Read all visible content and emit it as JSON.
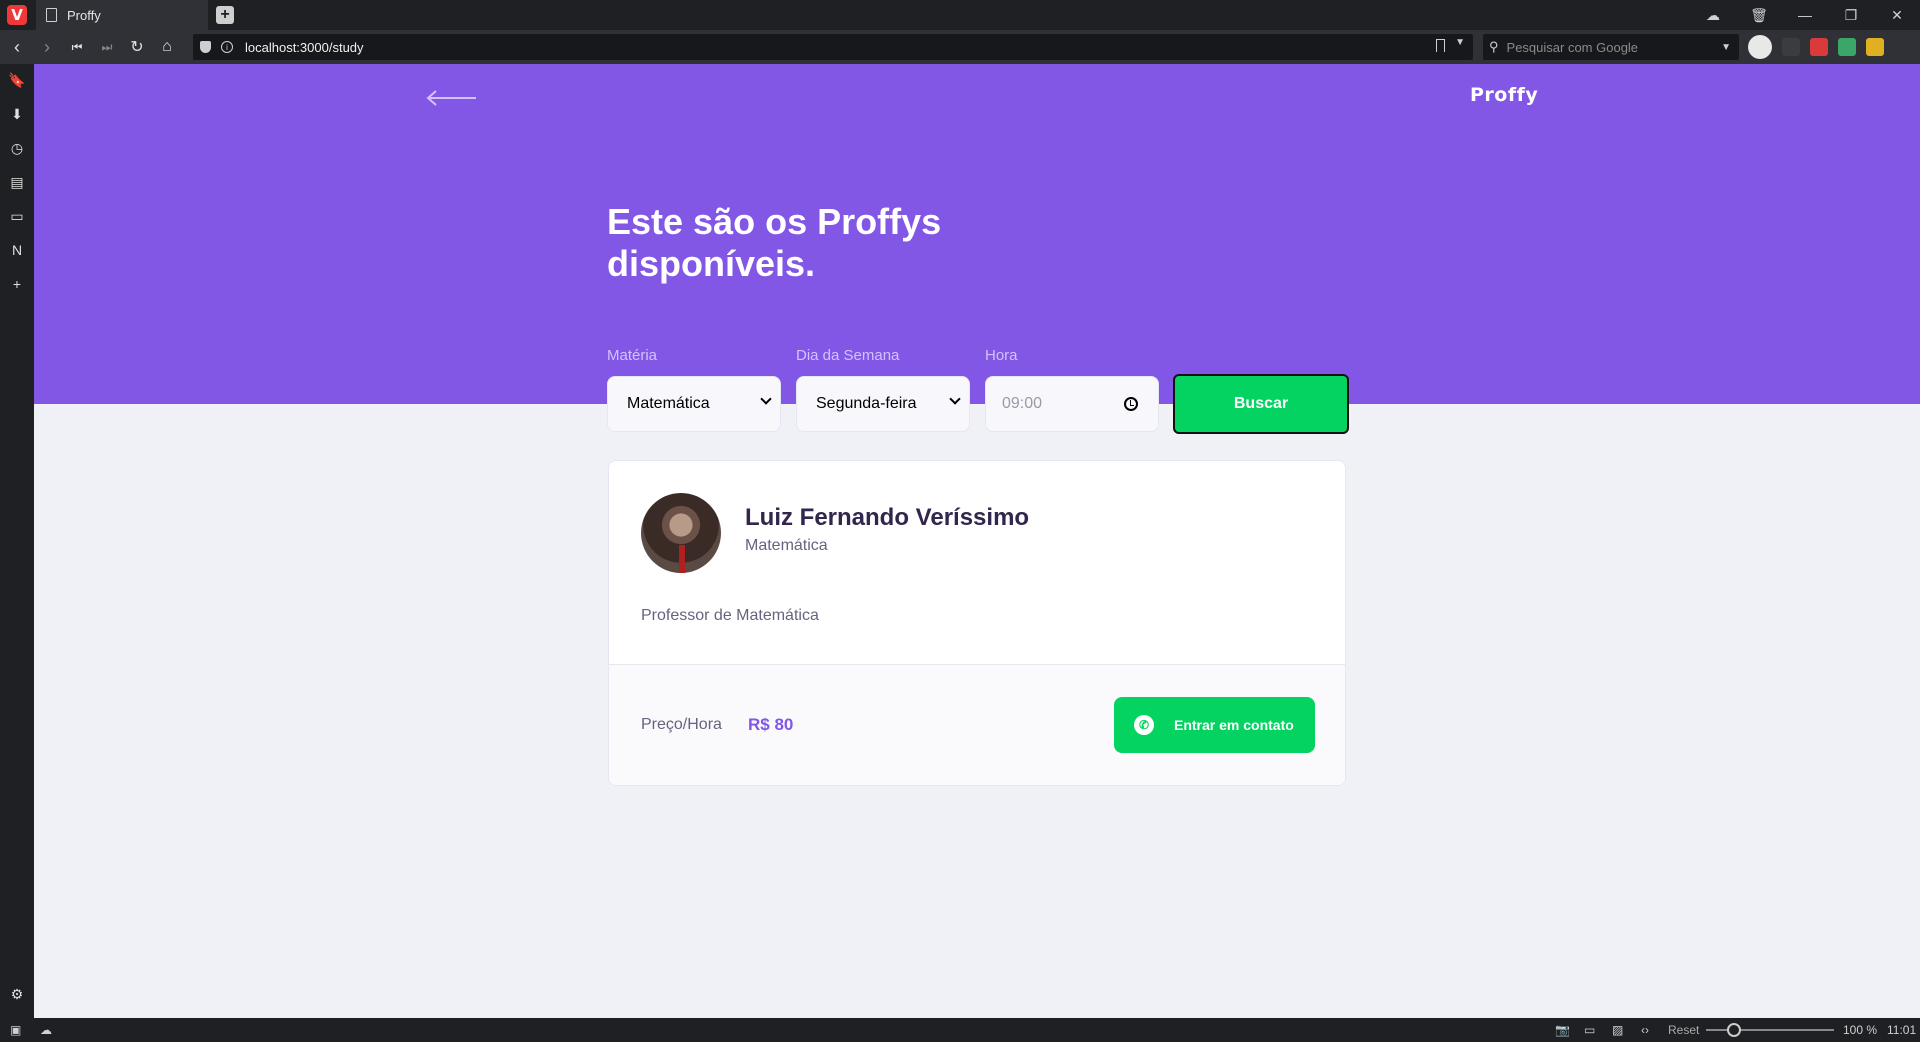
{
  "browser": {
    "tab_title": "Proffy",
    "url": "localhost:3000/study",
    "search_placeholder": "Pesquisar com Google",
    "status": {
      "reset_label": "Reset",
      "zoom": "100 %",
      "clock": "11:01"
    }
  },
  "header": {
    "brand": "Proffy",
    "title": "Este são os Proffys disponíveis."
  },
  "filters": {
    "subject_label": "Matéria",
    "subject_value": "Matemática",
    "weekday_label": "Dia da Semana",
    "weekday_value": "Segunda-feira",
    "time_label": "Hora",
    "time_value": "09:00",
    "search_button": "Buscar"
  },
  "teachers": [
    {
      "name": "Luiz Fernando Veríssimo",
      "subject": "Matemática",
      "bio": "Professor de Matemática",
      "price_label": "Preço/Hora",
      "price": "R$ 80",
      "contact_button": "Entrar em contato"
    }
  ],
  "colors": {
    "primary": "#8257e5",
    "secondary": "#04d361",
    "background": "#f0f0f7"
  }
}
